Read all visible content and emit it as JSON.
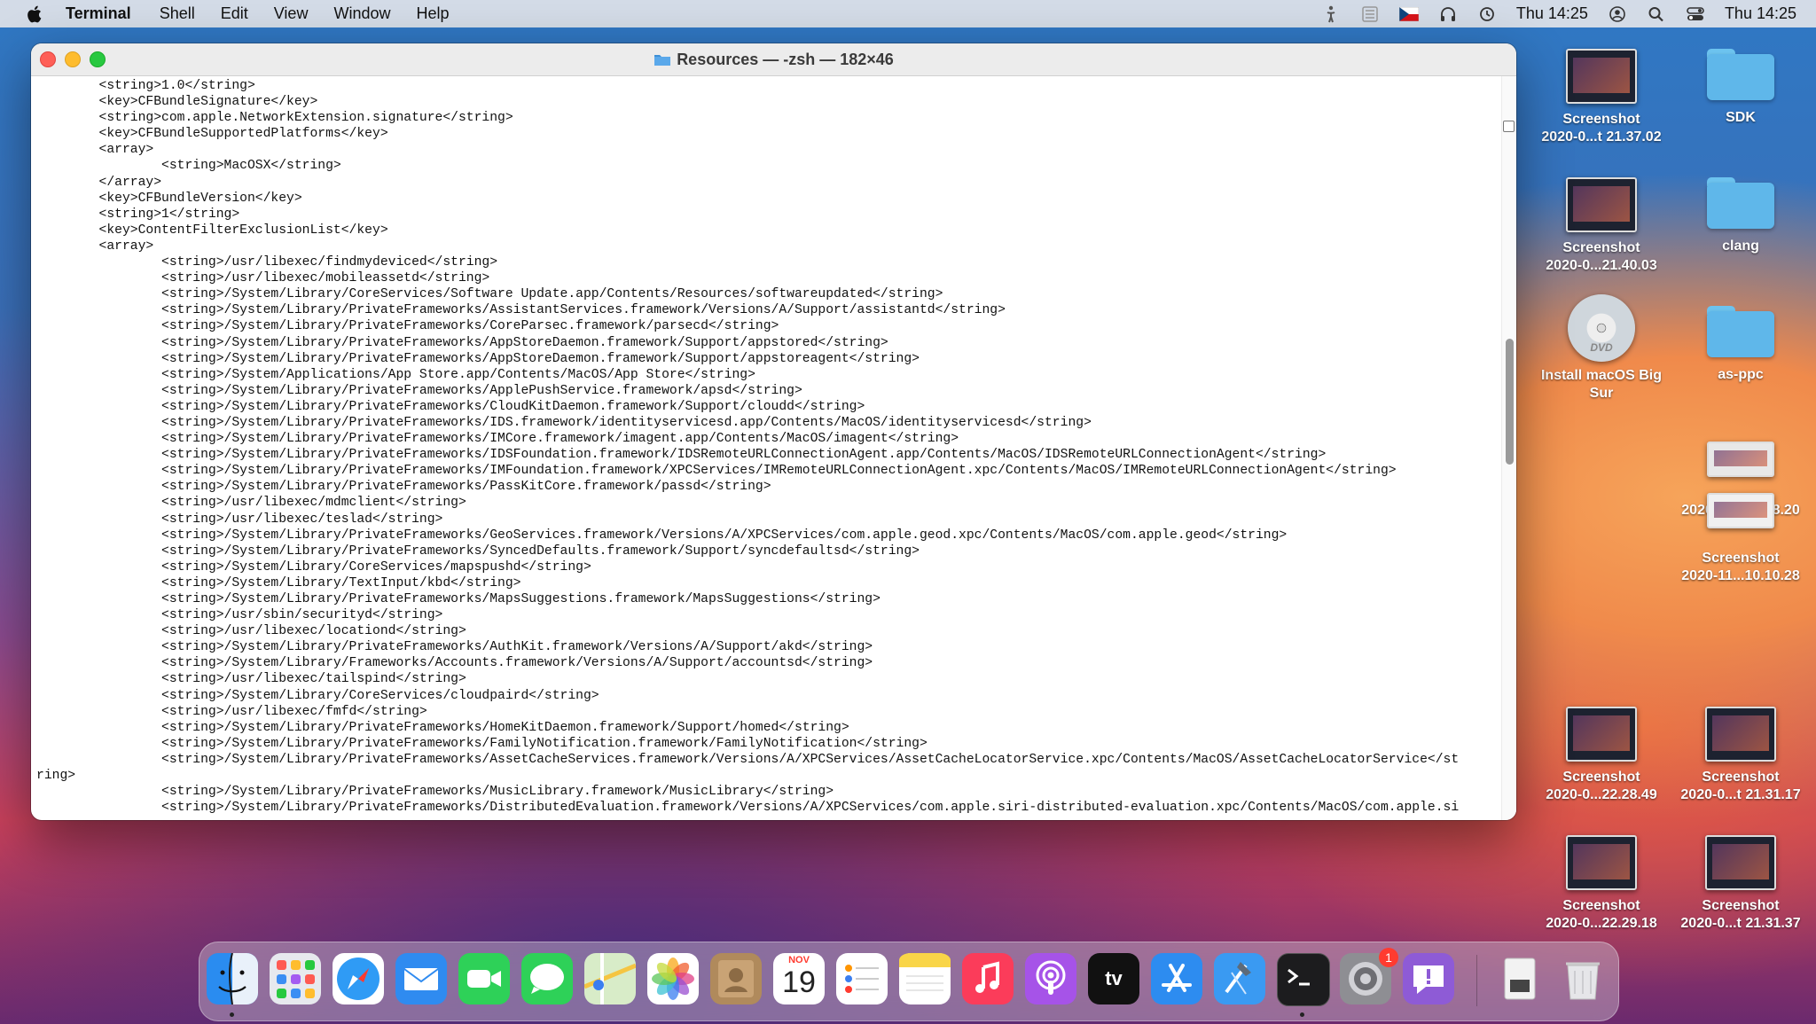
{
  "menubar": {
    "app_name": "Terminal",
    "menus": [
      "Shell",
      "Edit",
      "View",
      "Window",
      "Help"
    ],
    "clock": "Thu 14:25",
    "clock2": "Thu 14:25"
  },
  "window": {
    "title": "Resources — -zsh — 182×46",
    "lines": [
      "        <string>1.0</string>",
      "        <key>CFBundleSignature</key>",
      "        <string>com.apple.NetworkExtension.signature</string>",
      "        <key>CFBundleSupportedPlatforms</key>",
      "        <array>",
      "                <string>MacOSX</string>",
      "        </array>",
      "        <key>CFBundleVersion</key>",
      "        <string>1</string>",
      "        <key>ContentFilterExclusionList</key>",
      "        <array>",
      "                <string>/usr/libexec/findmydeviced</string>",
      "                <string>/usr/libexec/mobileassetd</string>",
      "                <string>/System/Library/CoreServices/Software Update.app/Contents/Resources/softwareupdated</string>",
      "                <string>/System/Library/PrivateFrameworks/AssistantServices.framework/Versions/A/Support/assistantd</string>",
      "                <string>/System/Library/PrivateFrameworks/CoreParsec.framework/parsecd</string>",
      "                <string>/System/Library/PrivateFrameworks/AppStoreDaemon.framework/Support/appstored</string>",
      "                <string>/System/Library/PrivateFrameworks/AppStoreDaemon.framework/Support/appstoreagent</string>",
      "                <string>/System/Applications/App Store.app/Contents/MacOS/App Store</string>",
      "                <string>/System/Library/PrivateFrameworks/ApplePushService.framework/apsd</string>",
      "                <string>/System/Library/PrivateFrameworks/CloudKitDaemon.framework/Support/cloudd</string>",
      "                <string>/System/Library/PrivateFrameworks/IDS.framework/identityservicesd.app/Contents/MacOS/identityservicesd</string>",
      "                <string>/System/Library/PrivateFrameworks/IMCore.framework/imagent.app/Contents/MacOS/imagent</string>",
      "                <string>/System/Library/PrivateFrameworks/IDSFoundation.framework/IDSRemoteURLConnectionAgent.app/Contents/MacOS/IDSRemoteURLConnectionAgent</string>",
      "                <string>/System/Library/PrivateFrameworks/IMFoundation.framework/XPCServices/IMRemoteURLConnectionAgent.xpc/Contents/MacOS/IMRemoteURLConnectionAgent</string>",
      "                <string>/System/Library/PrivateFrameworks/PassKitCore.framework/passd</string>",
      "                <string>/usr/libexec/mdmclient</string>",
      "                <string>/usr/libexec/teslad</string>",
      "                <string>/System/Library/PrivateFrameworks/GeoServices.framework/Versions/A/XPCServices/com.apple.geod.xpc/Contents/MacOS/com.apple.geod</string>",
      "                <string>/System/Library/PrivateFrameworks/SyncedDefaults.framework/Support/syncdefaultsd</string>",
      "                <string>/System/Library/CoreServices/mapspushd</string>",
      "                <string>/System/Library/TextInput/kbd</string>",
      "                <string>/System/Library/PrivateFrameworks/MapsSuggestions.framework/MapsSuggestions</string>",
      "                <string>/usr/sbin/securityd</string>",
      "                <string>/usr/libexec/locationd</string>",
      "                <string>/System/Library/PrivateFrameworks/AuthKit.framework/Versions/A/Support/akd</string>",
      "                <string>/System/Library/Frameworks/Accounts.framework/Versions/A/Support/accountsd</string>",
      "                <string>/usr/libexec/tailspind</string>",
      "                <string>/System/Library/CoreServices/cloudpaird</string>",
      "                <string>/usr/libexec/fmfd</string>",
      "                <string>/System/Library/PrivateFrameworks/HomeKitDaemon.framework/Support/homed</string>",
      "                <string>/System/Library/PrivateFrameworks/FamilyNotification.framework/FamilyNotification</string>",
      "                <string>/System/Library/PrivateFrameworks/AssetCacheServices.framework/Versions/A/XPCServices/AssetCacheLocatorService.xpc/Contents/MacOS/AssetCacheLocatorService</st",
      "ring>",
      "                <string>/System/Library/PrivateFrameworks/MusicLibrary.framework/MusicLibrary</string>",
      "                <string>/System/Library/PrivateFrameworks/DistributedEvaluation.framework/Versions/A/XPCServices/com.apple.siri-distributed-evaluation.xpc/Contents/MacOS/com.apple.si"
    ]
  },
  "desktop": [
    {
      "kind": "screenshot",
      "line1": "Screenshot",
      "line2": "2020-0...t 21.37.02"
    },
    {
      "kind": "folder",
      "line1": "SDK",
      "line2": ""
    },
    {
      "kind": "screenshot",
      "line1": "Screenshot",
      "line2": "2020-0...21.40.03"
    },
    {
      "kind": "folder",
      "line1": "clang",
      "line2": ""
    },
    {
      "kind": "dvd",
      "line1": "Install macOS Big",
      "line2": "Sur",
      "dvd_label": "DVD"
    },
    {
      "kind": "folder",
      "line1": "as-ppc",
      "line2": ""
    },
    {
      "kind": "screenshot",
      "line1": "",
      "line2": "2020-11...15.08.20"
    },
    {
      "kind": "screenshot",
      "line1": "Screenshot",
      "line2": "2020-11...10.10.28"
    },
    {
      "kind": "screenshot",
      "line1": "Screenshot",
      "line2": "2020-0...22.28.49"
    },
    {
      "kind": "screenshot",
      "line1": "Screenshot",
      "line2": "2020-0...t 21.31.17"
    },
    {
      "kind": "screenshot",
      "line1": "Screenshot",
      "line2": "2020-0...22.29.18"
    },
    {
      "kind": "screenshot",
      "line1": "Screenshot",
      "line2": "2020-0...t 21.31.37"
    }
  ],
  "dock": {
    "apps": [
      "finder",
      "launchpad",
      "safari",
      "mail",
      "facetime",
      "messages",
      "maps",
      "photos",
      "contacts",
      "calendar",
      "reminders",
      "notes",
      "music",
      "podcasts",
      "tv",
      "app-store",
      "xcode",
      "terminal",
      "system-preferences",
      "feedback-assistant"
    ],
    "calendar_month": "NOV",
    "calendar_day": "19",
    "tv_label": "tv",
    "system_preferences_badge": "1"
  },
  "colors": {
    "close": "#fe5f57",
    "minimize": "#febc2e",
    "maximize": "#28c840",
    "folder": "#5fb7ea"
  }
}
